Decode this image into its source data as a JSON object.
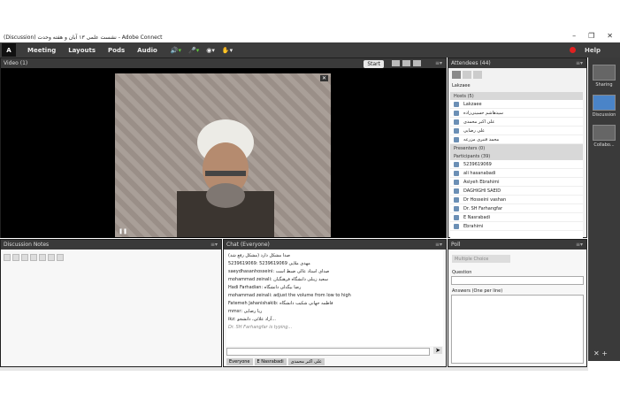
{
  "window": {
    "title": "(Discussion) نشست علمی ۱۳ آبان و هفته وحدت - Adobe Connect"
  },
  "menu": {
    "items": [
      "Meeting",
      "Layouts",
      "Pods",
      "Audio"
    ],
    "help": "Help"
  },
  "video": {
    "title": "Video",
    "count": "(1)",
    "start": "Start"
  },
  "attendees": {
    "title": "Attendees",
    "count": "(44)",
    "sort": "Lakzaee",
    "hosts_label": "Hosts (5)",
    "presenters_label": "Presenters (0)",
    "participants_label": "Participants (39)",
    "hosts": [
      "Lakzaee",
      "سیدهاشم حسینی‌زاده",
      "علی اکبر محمدی",
      "علی رضایی",
      "محمد قنبری مزرعه"
    ],
    "participants": [
      "5239619069",
      "ali hasanabadi",
      "Asiyeh Ebrahimi",
      "DAGHIGHI SAEID",
      "Dr Hosseini vashan",
      "Dr. SH Farhangfar",
      "E Nasrabadi",
      "Ebrahimi"
    ]
  },
  "notes": {
    "title": "Discussion Notes"
  },
  "chat": {
    "title": "Chat",
    "scope": "(Everyone)",
    "messages": [
      "صدا مشکل دارد (مشکل رفع شد)",
      "5239619069: 5239619069 مهدی ملایی",
      "saeydhasanhosseini: صدای استاد عالی ضبط است",
      "mohammad zeinali: سعید زینلی دانشگاه فرهنگیان",
      "Hadi Farhadian: رضا بیگدلی دانشگاه",
      "mohammad zeinali: adjust the volume from low to high",
      "Fatemeh Jahanishakib: فاطمه جهانی شکیب دانشگاه",
      "mmsr: ریا رضایی",
      "ikz: آزاد علائی، دانشجو...",
      "Dr. SH Farhangfar is typing..."
    ],
    "tabs": [
      "Everyone",
      "E Nasrabadi",
      "علی اکبر محمدی"
    ]
  },
  "poll": {
    "title": "Poll",
    "mode": "Multiple Choice",
    "question": "Question",
    "answers": "Answers (One per line)"
  },
  "sidebar": {
    "items": [
      "Sharing",
      "Discussion",
      "Collabo..."
    ]
  }
}
